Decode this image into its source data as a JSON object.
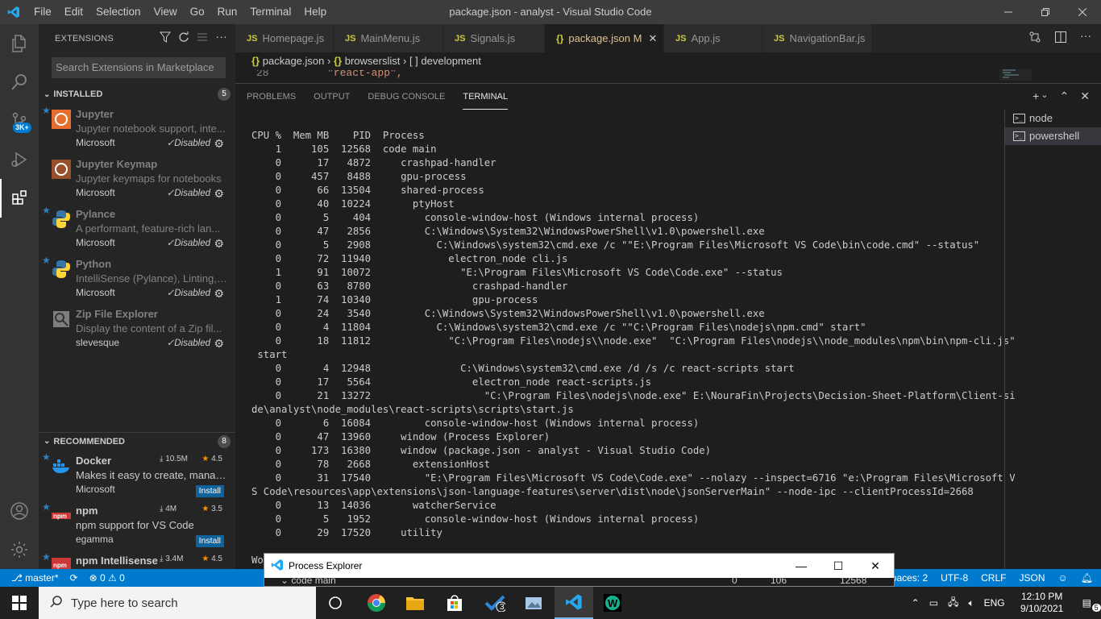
{
  "window": {
    "title": "package.json - analyst - Visual Studio Code"
  },
  "menu": [
    "File",
    "Edit",
    "Selection",
    "View",
    "Go",
    "Run",
    "Terminal",
    "Help"
  ],
  "activity": {
    "scm_badge": "3K+"
  },
  "sidebar": {
    "title": "EXTENSIONS",
    "search_placeholder": "Search Extensions in Marketplace",
    "installed": {
      "label": "INSTALLED",
      "count": "5",
      "items": [
        {
          "name": "Jupyter",
          "desc": "Jupyter notebook support, inte...",
          "publisher": "Microsoft",
          "status": "Disabled",
          "starred": true
        },
        {
          "name": "Jupyter Keymap",
          "desc": "Jupyter keymaps for notebooks",
          "publisher": "Microsoft",
          "status": "Disabled",
          "starred": false
        },
        {
          "name": "Pylance",
          "desc": "A performant, feature-rich lan...",
          "publisher": "Microsoft",
          "status": "Disabled",
          "starred": true
        },
        {
          "name": "Python",
          "desc": "IntelliSense (Pylance), Linting, ...",
          "publisher": "Microsoft",
          "status": "Disabled",
          "starred": true
        },
        {
          "name": "Zip File Explorer",
          "desc": "Display the content of a Zip fil...",
          "publisher": "slevesque",
          "status": "Disabled",
          "starred": false
        }
      ]
    },
    "recommended": {
      "label": "RECOMMENDED",
      "count": "8",
      "items": [
        {
          "name": "Docker",
          "downloads": "10.5M",
          "rating": "4.5",
          "desc": "Makes it easy to create, manag...",
          "publisher": "Microsoft",
          "action": "Install"
        },
        {
          "name": "npm",
          "downloads": "4M",
          "rating": "3.5",
          "desc": "npm support for VS Code",
          "publisher": "egamma",
          "action": "Install"
        },
        {
          "name": "npm Intellisense",
          "downloads": "3.4M",
          "rating": "4.5"
        }
      ]
    }
  },
  "tabs": [
    {
      "label": "Homepage.js"
    },
    {
      "label": "MainMenu.js"
    },
    {
      "label": "Signals.js"
    },
    {
      "label": "package.json",
      "modified": "M"
    },
    {
      "label": "App.js"
    },
    {
      "label": "NavigationBar.js"
    }
  ],
  "breadcrumb": {
    "file": "package.json",
    "sep": "›",
    "node1": "browserslist",
    "node2": "development"
  },
  "editor": {
    "line_number": "28",
    "line_text": "\"react-app\","
  },
  "panel": {
    "tabs": [
      "PROBLEMS",
      "OUTPUT",
      "DEBUG CONSOLE",
      "TERMINAL"
    ],
    "terminals": [
      "node",
      "powershell"
    ],
    "terminal_output": "CPU %  Mem MB    PID  Process\n    1     105  12568  code main\n    0      17   4872     crashpad-handler\n    0     457   8488     gpu-process\n    0      66  13504     shared-process\n    0      40  10224       ptyHost\n    0       5    404         console-window-host (Windows internal process)\n    0      47   2856         C:\\Windows\\System32\\WindowsPowerShell\\v1.0\\powershell.exe\n    0       5   2908           C:\\Windows\\system32\\cmd.exe /c \"\"E:\\Program Files\\Microsoft VS Code\\bin\\code.cmd\" --status\"\n    0      72  11940             electron_node cli.js\n    1      91  10072               \"E:\\Program Files\\Microsoft VS Code\\Code.exe\" --status\n    0      63   8780                 crashpad-handler\n    1      74  10340                 gpu-process\n    0      24   3540         C:\\Windows\\System32\\WindowsPowerShell\\v1.0\\powershell.exe\n    0       4  11804           C:\\Windows\\system32\\cmd.exe /c \"\"C:\\Program Files\\nodejs\\npm.cmd\" start\"\n    0      18  11812             \"C:\\Program Files\\nodejs\\\\node.exe\"  \"C:\\Program Files\\nodejs\\\\node_modules\\npm\\bin\\npm-cli.js\"\n start\n    0       4  12948               C:\\Windows\\system32\\cmd.exe /d /s /c react-scripts start\n    0      17   5564                 electron_node react-scripts.js\n    0      21  13272                   \"C:\\Program Files\\nodejs\\node.exe\" E:\\NouraFin\\Projects\\Decision-Sheet-Platform\\Client-si\nde\\analyst\\node_modules\\react-scripts\\scripts\\start.js\n    0       6  16084         console-window-host (Windows internal process)\n    0      47  13960     window (Process Explorer)\n    0     173  16380     window (package.json - analyst - Visual Studio Code)\n    0      78   2668       extensionHost\n    0      31  17540         \"E:\\Program Files\\Microsoft VS Code\\Code.exe\" --nolazy --inspect=6716 \"e:\\Program Files\\Microsoft V\nS Code\\resources\\app\\extensions\\json-language-features\\server\\dist\\node\\jsonServerMain\" --node-ipc --clientProcessId=2668\n    0      13  14036       watcherService\n    0       5   1952         console-window-host (Windows internal process)\n    0      29  17520     utility",
    "trailing": "Wo"
  },
  "statusbar": {
    "branch": "master*",
    "errors": "0",
    "warnings": "0",
    "spaces": "Spaces: 2",
    "encoding": "UTF-8",
    "eol": "CRLF",
    "language": "JSON",
    "notifications": "5"
  },
  "process_explorer": {
    "title": "Process Explorer",
    "row": {
      "name": "code main",
      "cpu": "0",
      "mem": "106",
      "pid": "12568"
    }
  },
  "taskbar": {
    "search_placeholder": "Type here to search",
    "check_badge": "3",
    "lang": "ENG",
    "time": "12:10 PM",
    "date": "9/10/2021",
    "notif_count": "5"
  },
  "colors": {
    "accent": "#007acc",
    "title_bar": "#3c3c3c",
    "activity_bar": "#333333",
    "sidebar": "#252526",
    "editor": "#1e1e1e"
  }
}
